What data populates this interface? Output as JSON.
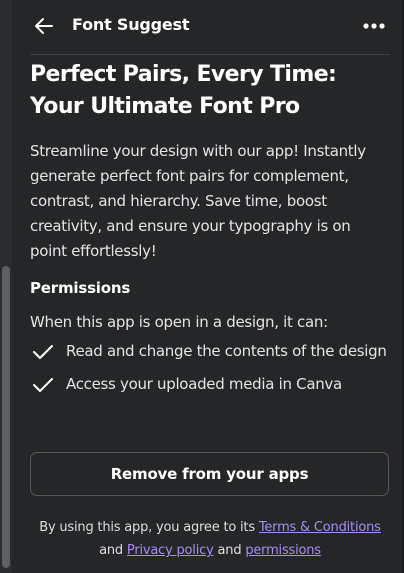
{
  "header": {
    "title": "Font Suggest",
    "back_icon": "arrow-left-icon",
    "more_icon": "more-horizontal-icon"
  },
  "app": {
    "title_line1": "Perfect Pairs, Every Time:",
    "title_line2": "Your Ultimate Font Pro",
    "description": "Streamline your design with our app! Instantly generate perfect font pairs for complement, contrast, and hierarchy. Save time, boost creativity, and ensure your typography is on point effortlessly!"
  },
  "permissions": {
    "heading": "Permissions",
    "intro": "When this app is open in a design, it can:",
    "items": [
      {
        "label": "Read and change the contents of the design",
        "icon": "check-icon"
      },
      {
        "label": "Access your uploaded media in Canva",
        "icon": "check-icon"
      }
    ]
  },
  "actions": {
    "remove_label": "Remove from your apps"
  },
  "footer": {
    "prefix": "By using this app, you agree to its",
    "terms_link": "Terms & Conditions",
    "and_1": "and",
    "privacy_link": "Privacy policy",
    "and_2": "and",
    "permissions_link": "permissions"
  },
  "colors": {
    "background": "#252627",
    "text": "#ffffff",
    "link": "#a98bf7",
    "border": "#58595b"
  }
}
